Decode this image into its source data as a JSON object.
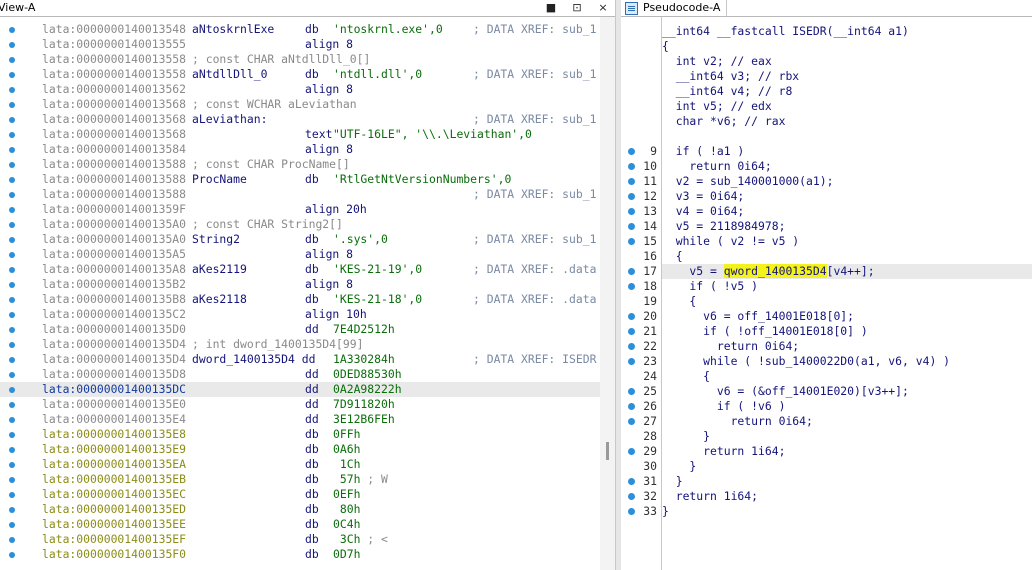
{
  "left_pane": {
    "title": "View-A",
    "controls": {
      "pin": "■",
      "float": "⊡",
      "close": "×"
    },
    "lines": [
      {
        "addr": "lata:0000000140013548",
        "name": "aNtoskrnlExe",
        "mnem": "db",
        "oper": "'ntoskrnl.exe',0",
        "xref": "; DATA XREF: sub_1",
        "bullet": true
      },
      {
        "addr": "lata:0000000140013555",
        "mnem": "align 8",
        "bullet": true
      },
      {
        "addr": "lata:0000000140013558",
        "comment": "; const CHAR aNtdllDll_0[]",
        "bullet": true
      },
      {
        "addr": "lata:0000000140013558",
        "name": "aNtdllDll_0",
        "mnem": "db",
        "oper": "'ntdll.dll',0",
        "xref": "; DATA XREF: sub_1",
        "bullet": true
      },
      {
        "addr": "lata:0000000140013562",
        "mnem": "align 8",
        "bullet": true
      },
      {
        "addr": "lata:0000000140013568",
        "comment": "; const WCHAR aLeviathan",
        "bullet": true
      },
      {
        "addr": "lata:0000000140013568",
        "name": "aLeviathan:",
        "xref": "; DATA XREF: sub_1",
        "bullet": true
      },
      {
        "addr": "lata:0000000140013568",
        "mnem": "text",
        "oper": "\"UTF-16LE\", '\\\\.\\Leviathan',0",
        "bullet": true
      },
      {
        "addr": "lata:0000000140013584",
        "mnem": "align 8",
        "bullet": true
      },
      {
        "addr": "lata:0000000140013588",
        "comment": "; const CHAR ProcName[]",
        "bullet": true
      },
      {
        "addr": "lata:0000000140013588",
        "name": "ProcName",
        "mnem": "db",
        "oper": "'RtlGetNtVersionNumbers',0",
        "bullet": true
      },
      {
        "addr": "lata:0000000140013588",
        "xref": "; DATA XREF: sub_1",
        "bullet": true
      },
      {
        "addr": "lata:000000014001359F",
        "mnem": "align 20h",
        "bullet": true
      },
      {
        "addr": "lata:00000001400135A0",
        "comment": "; const CHAR String2[]",
        "bullet": true
      },
      {
        "addr": "lata:00000001400135A0",
        "name": "String2",
        "mnem": "db",
        "oper": "'.sys',0",
        "xref": "; DATA XREF: sub_1",
        "bullet": true
      },
      {
        "addr": "lata:00000001400135A5",
        "mnem": "align 8",
        "bullet": true
      },
      {
        "addr": "lata:00000001400135A8",
        "name": "aKes2119",
        "mnem": "db",
        "oper": "'KES-21-19',0",
        "xref": "; DATA XREF: .data",
        "bullet": true
      },
      {
        "addr": "lata:00000001400135B2",
        "mnem": "align 8",
        "bullet": true
      },
      {
        "addr": "lata:00000001400135B8",
        "name": "aKes2118",
        "mnem": "db",
        "oper": "'KES-21-18',0",
        "xref": "; DATA XREF: .data",
        "bullet": true
      },
      {
        "addr": "lata:00000001400135C2",
        "mnem": "align 10h",
        "bullet": true
      },
      {
        "addr": "lata:00000001400135D0",
        "mnem": "dd",
        "oper": "7E4D2512h",
        "bullet": true
      },
      {
        "addr": "lata:00000001400135D4",
        "comment": "; int dword_1400135D4[99]",
        "bullet": true
      },
      {
        "addr": "lata:00000001400135D4",
        "name": "dword_1400135D4 dd",
        "oper": "1A330284h",
        "xref": "; DATA XREF: ISEDR",
        "bullet": true
      },
      {
        "addr": "lata:00000001400135D8",
        "mnem": "dd",
        "oper": "0DED88530h",
        "bullet": true
      },
      {
        "addr": "lata:00000001400135DC",
        "mnem": "dd",
        "oper": "0A2A98222h",
        "bullet": true,
        "highlight": true
      },
      {
        "addr": "lata:00000001400135E0",
        "mnem": "dd",
        "oper": "7D911820h",
        "bullet": true
      },
      {
        "addr": "lata:00000001400135E4",
        "mnem": "dd",
        "oper": "3E12B6FEh",
        "bullet": true
      },
      {
        "addr": "lata:00000001400135E8",
        "mnem": "db",
        "oper": "0FFh",
        "bullet": true,
        "olive": true
      },
      {
        "addr": "lata:00000001400135E9",
        "mnem": "db",
        "oper": "0A6h",
        "bullet": true,
        "olive": true
      },
      {
        "addr": "lata:00000001400135EA",
        "mnem": "db",
        "oper": " 1Ch",
        "bullet": true,
        "olive": true
      },
      {
        "addr": "lata:00000001400135EB",
        "mnem": "db",
        "oper": " 57h",
        "tcomment": " ; W",
        "bullet": true,
        "olive": true
      },
      {
        "addr": "lata:00000001400135EC",
        "mnem": "db",
        "oper": "0EFh",
        "bullet": true,
        "olive": true
      },
      {
        "addr": "lata:00000001400135ED",
        "mnem": "db",
        "oper": " 80h",
        "bullet": true,
        "olive": true
      },
      {
        "addr": "lata:00000001400135EE",
        "mnem": "db",
        "oper": "0C4h",
        "bullet": true,
        "olive": true
      },
      {
        "addr": "lata:00000001400135EF",
        "mnem": "db",
        "oper": " 3Ch",
        "tcomment": " ; <",
        "bullet": true,
        "olive": true
      },
      {
        "addr": "lata:00000001400135F0",
        "mnem": "db",
        "oper": "0D7h",
        "bullet": true,
        "olive": true
      }
    ]
  },
  "right_pane": {
    "tab_title": "Pseudocode-A",
    "lines": [
      {
        "num": "",
        "code": "__int64 __fastcall ISEDR(__int64 a1)",
        "bullet": false
      },
      {
        "num": "",
        "code": "{",
        "bullet": false
      },
      {
        "num": "",
        "code": "  int v2; // eax",
        "bullet": false
      },
      {
        "num": "",
        "code": "  __int64 v3; // rbx",
        "bullet": false
      },
      {
        "num": "",
        "code": "  __int64 v4; // r8",
        "bullet": false
      },
      {
        "num": "",
        "code": "  int v5; // edx",
        "bullet": false
      },
      {
        "num": "",
        "code": "  char *v6; // rax",
        "bullet": false
      },
      {
        "num": "",
        "code": "",
        "bullet": false
      },
      {
        "num": "9",
        "code": "  if ( !a1 )",
        "bullet": true
      },
      {
        "num": "10",
        "code": "    return 0i64;",
        "bullet": true
      },
      {
        "num": "11",
        "code": "  v2 = sub_140001000(a1);",
        "bullet": true
      },
      {
        "num": "12",
        "code": "  v3 = 0i64;",
        "bullet": true
      },
      {
        "num": "13",
        "code": "  v4 = 0i64;",
        "bullet": true
      },
      {
        "num": "14",
        "code": "  v5 = 2118984978;",
        "bullet": true
      },
      {
        "num": "15",
        "code": "  while ( v2 != v5 )",
        "bullet": true
      },
      {
        "num": "16",
        "code": "  {",
        "bullet": false
      },
      {
        "num": "17",
        "code_pre": "    v5 = ",
        "code_hl": "qword_1400135D4",
        "code_post": "[v4++];",
        "bullet": true,
        "highlight": true
      },
      {
        "num": "18",
        "code": "    if ( !v5 )",
        "bullet": true
      },
      {
        "num": "19",
        "code": "    {",
        "bullet": false
      },
      {
        "num": "20",
        "code": "      v6 = off_14001E018[0];",
        "bullet": true
      },
      {
        "num": "21",
        "code": "      if ( !off_14001E018[0] )",
        "bullet": true
      },
      {
        "num": "22",
        "code": "        return 0i64;",
        "bullet": true
      },
      {
        "num": "23",
        "code": "      while ( !sub_1400022D0(a1, v6, v4) )",
        "bullet": true
      },
      {
        "num": "24",
        "code": "      {",
        "bullet": false
      },
      {
        "num": "25",
        "code": "        v6 = (&off_14001E020)[v3++];",
        "bullet": true
      },
      {
        "num": "26",
        "code": "        if ( !v6 )",
        "bullet": true
      },
      {
        "num": "27",
        "code": "          return 0i64;",
        "bullet": true
      },
      {
        "num": "28",
        "code": "      }",
        "bullet": false
      },
      {
        "num": "29",
        "code": "      return 1i64;",
        "bullet": true
      },
      {
        "num": "30",
        "code": "    }",
        "bullet": false
      },
      {
        "num": "31",
        "code": "  }",
        "bullet": true
      },
      {
        "num": "32",
        "code": "  return 1i64;",
        "bullet": true
      },
      {
        "num": "33",
        "code": "}",
        "bullet": true
      }
    ]
  }
}
